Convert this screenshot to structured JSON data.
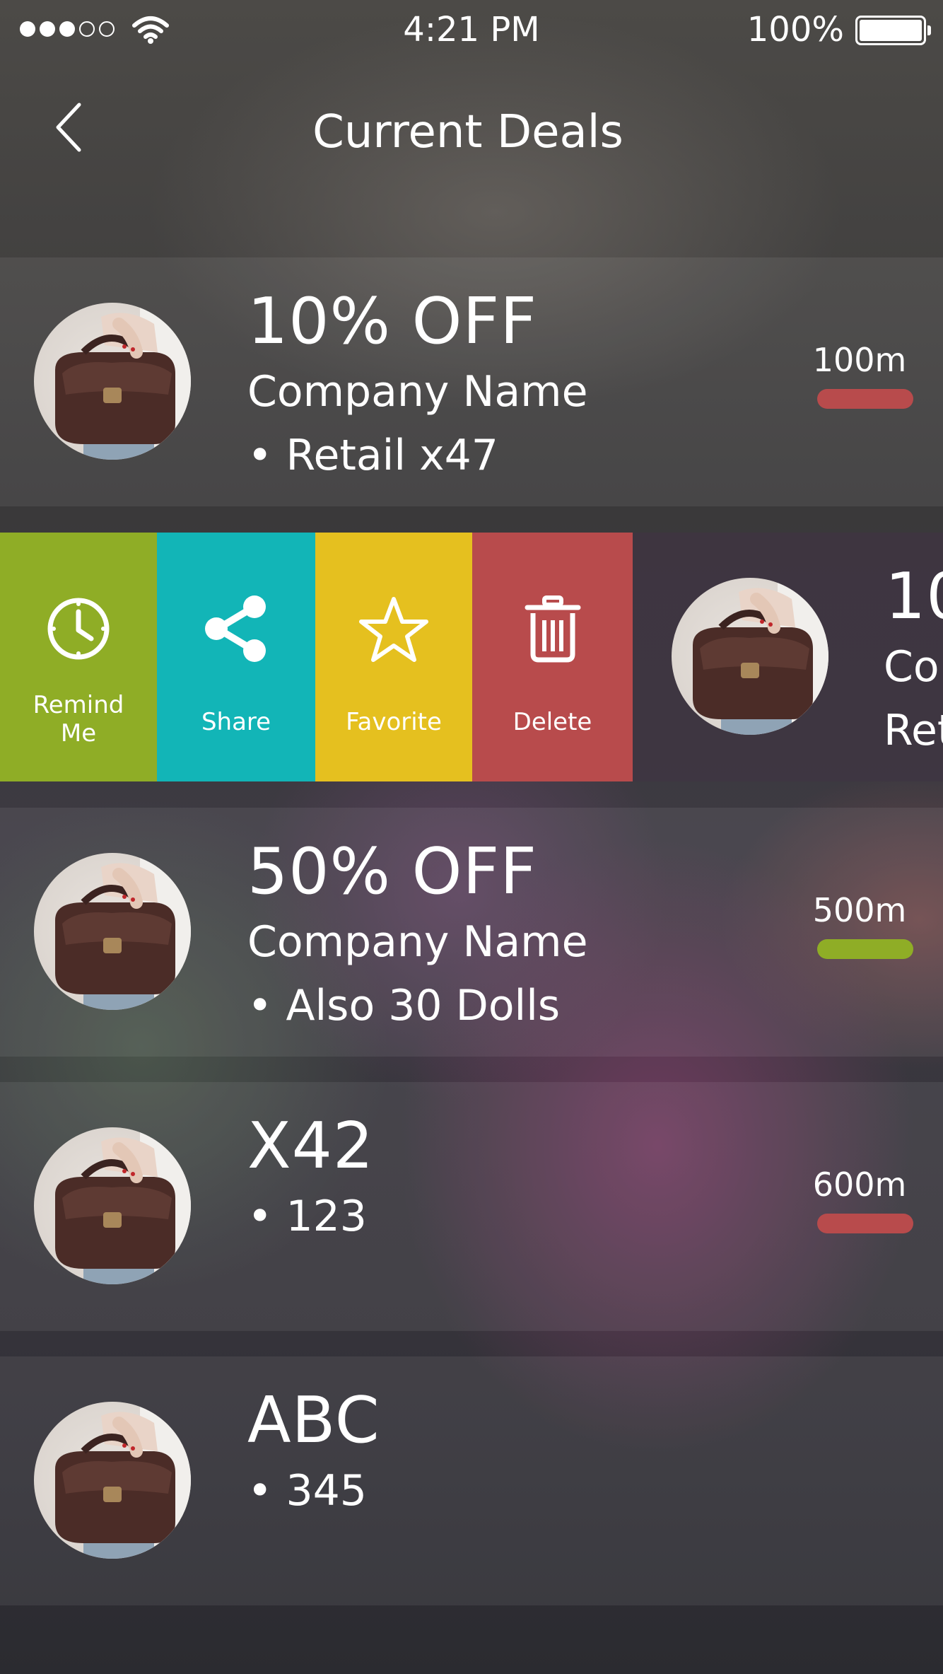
{
  "status_bar": {
    "time": "4:21 PM",
    "battery": "100%",
    "signal_icon": "signal-dots-icon",
    "wifi_icon": "wifi-icon",
    "battery_icon": "battery-icon"
  },
  "nav": {
    "title": "Current Deals",
    "back_icon": "chevron-left-icon"
  },
  "deals": [
    {
      "headline": "10% OFF",
      "company": "Company Name",
      "detail": "• Retail x47",
      "distance": "100m",
      "distance_color": "#b84b4c"
    },
    {
      "headline": "10",
      "company": "Co",
      "detail": "Ret"
    },
    {
      "headline": "50% OFF",
      "company": "Company Name",
      "detail": "• Also 30 Dolls",
      "distance": "500m",
      "distance_color": "#8fad26"
    },
    {
      "headline": "X42",
      "detail": "• 123",
      "distance": "600m",
      "distance_color": "#b84b4c"
    },
    {
      "headline": "ABC",
      "detail": "• 345"
    }
  ],
  "swipe_actions": [
    {
      "label_line1": "Remind",
      "label_line2": "Me",
      "icon": "clock-icon",
      "color": "#8fad26"
    },
    {
      "label": "Share",
      "icon": "share-icon",
      "color": "#12b5b7"
    },
    {
      "label": "Favorite",
      "icon": "star-icon",
      "color": "#e5c01f"
    },
    {
      "label": "Delete",
      "icon": "trash-icon",
      "color": "#b84b4c"
    }
  ]
}
